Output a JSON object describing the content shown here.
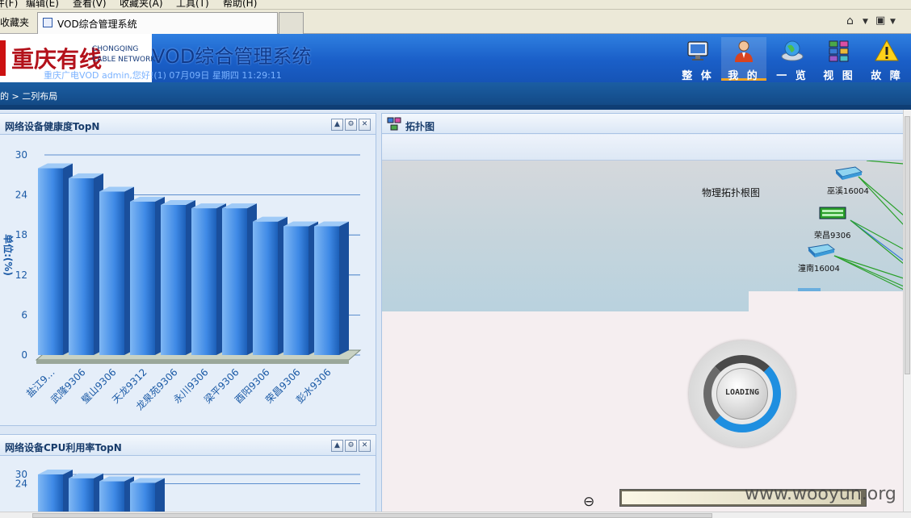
{
  "browser": {
    "menu": [
      "文件(F)",
      "编辑(E)",
      "查看(V)",
      "收藏夹(A)",
      "工具(T)",
      "帮助(H)"
    ],
    "favorites_label": "收藏夹",
    "tab_title": "VOD综合管理系统"
  },
  "header": {
    "brand_cn": "重庆有线",
    "brand_en_line1": "CHONGQING",
    "brand_en_line2": "CABLE NETWORKS",
    "app_title": "VOD综合管理系统",
    "subline": "重庆广电VOD admin,您好!(1) 07月09日 星期四 11:29:11",
    "nav": [
      {
        "label": "整 体",
        "icon": "monitor-icon",
        "active": false
      },
      {
        "label": "我 的",
        "icon": "user-icon",
        "active": true
      },
      {
        "label": "一 览",
        "icon": "globe-icon",
        "active": false
      },
      {
        "label": "视 图",
        "icon": "servers-icon",
        "active": false
      },
      {
        "label": "故 障",
        "icon": "warning-icon",
        "active": false
      }
    ]
  },
  "breadcrumb": "的 > 二列布局",
  "panels": {
    "health": {
      "title": "网络设备健康度TopN"
    },
    "cpu": {
      "title": "网络设备CPU利用率TopN"
    },
    "topology": {
      "title": "拓扑图",
      "map_label": "物理拓扑根图",
      "nodes": [
        "巫溪16004",
        "荣昌9306",
        "潼南16004"
      ],
      "loading_text": "LOADING"
    }
  },
  "colors": {
    "header_blue": "#1a5fc8",
    "bar_blue": "#2f7fe0",
    "brand_red": "#b3121b"
  },
  "chart_data": [
    {
      "type": "bar",
      "title": "网络设备健康度TopN",
      "ylabel": "单位:(%)",
      "ylim": [
        0,
        30
      ],
      "yticks": [
        0,
        6,
        12,
        18,
        24,
        30
      ],
      "categories": [
        "盐江9…",
        "武隆9306",
        "璧山9306",
        "天龙9312",
        "龙泉苑9306",
        "永川9306",
        "梁平9306",
        "酉阳9306",
        "荣昌9306",
        "彭水9306"
      ],
      "values": [
        28,
        26.5,
        24.5,
        23,
        22.5,
        22,
        22,
        20,
        19.3,
        19.3
      ]
    },
    {
      "type": "bar",
      "title": "网络设备CPU利用率TopN",
      "ylim": [
        0,
        30
      ],
      "yticks": [
        24,
        30
      ],
      "categories": [],
      "values": [
        30,
        27.5,
        25.5,
        24.5
      ]
    }
  ],
  "watermark": "www.wooyun.org"
}
